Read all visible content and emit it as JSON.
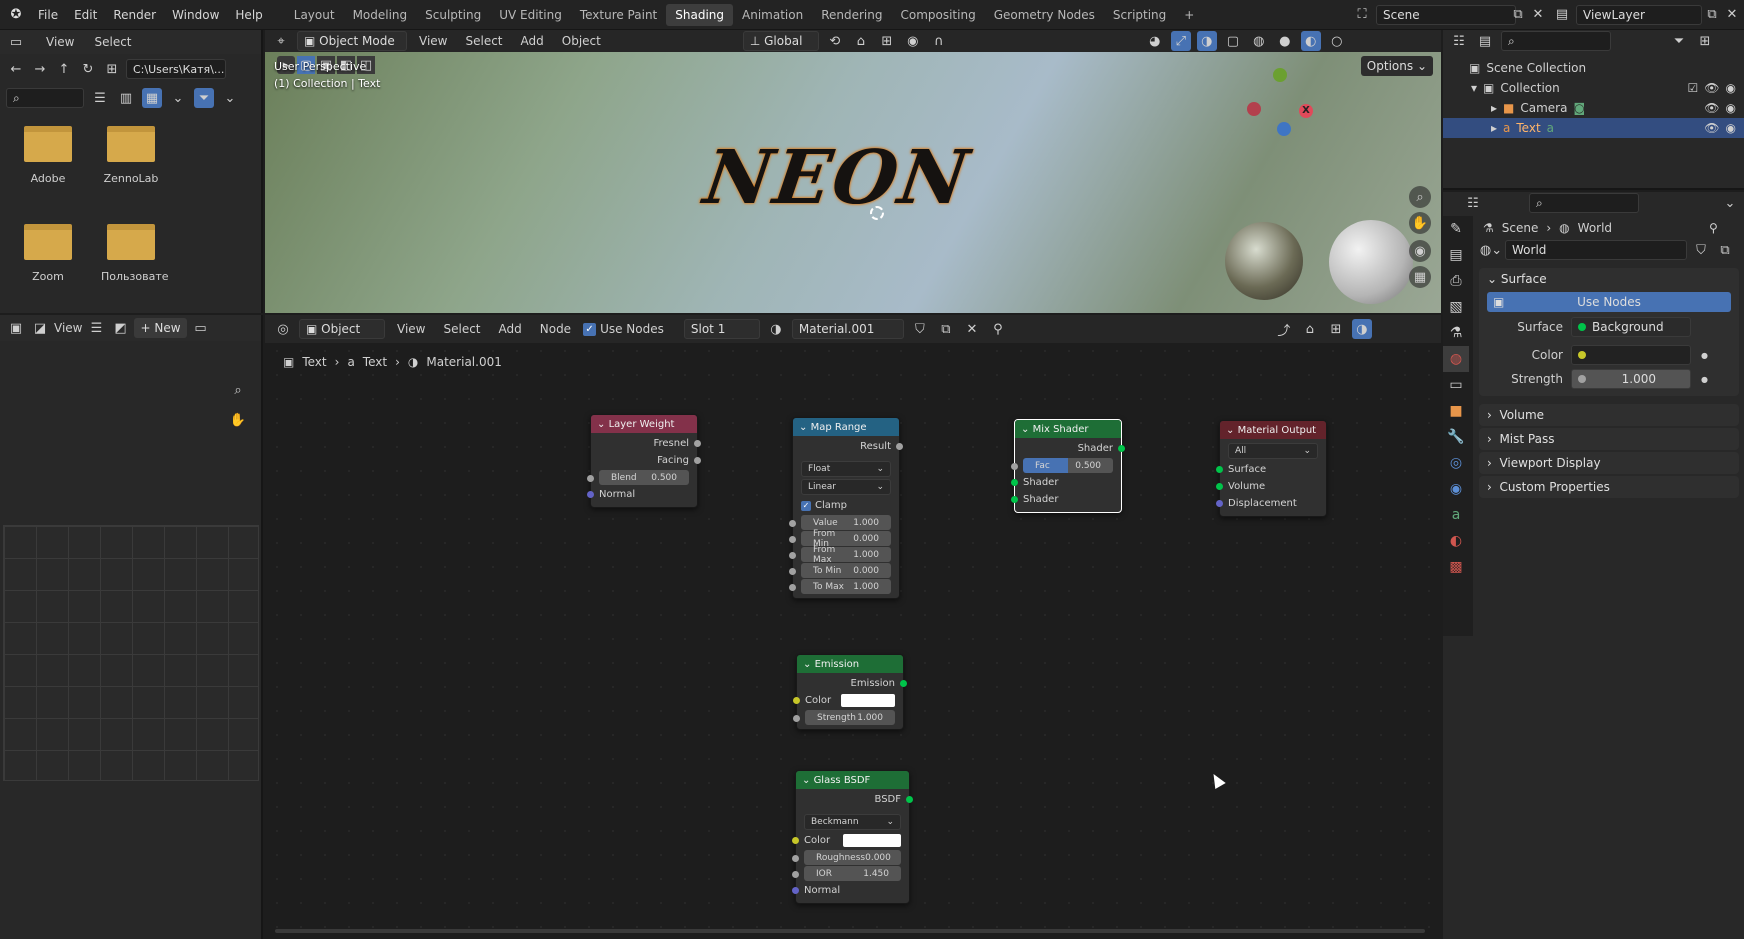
{
  "topbar": {
    "menus": [
      "File",
      "Edit",
      "Render",
      "Window",
      "Help"
    ],
    "workspaces": [
      "Layout",
      "Modeling",
      "Sculpting",
      "UV Editing",
      "Texture Paint",
      "Shading",
      "Animation",
      "Rendering",
      "Compositing",
      "Geometry Nodes",
      "Scripting"
    ],
    "active_workspace": "Shading",
    "add_tab": "+",
    "scene": "Scene",
    "view_layer": "ViewLayer"
  },
  "file_browser": {
    "menus": [
      "View",
      "Select"
    ],
    "path": "C:\\Users\\Катя\\...",
    "folders": [
      "Adobe",
      "ZennoLab",
      "Zoom",
      "Пользовате"
    ]
  },
  "image_editor": {
    "view_label": "View",
    "new_label": "New"
  },
  "viewport": {
    "mode": "Object Mode",
    "menus": [
      "View",
      "Select",
      "Add",
      "Object"
    ],
    "transform": "Global",
    "options_label": "Options",
    "info_line1": "User Perspective",
    "info_line2": "(1) Collection | Text",
    "neon_text": "NEON",
    "gizmo_x": "X"
  },
  "outliner": {
    "scene_collection": "Scene Collection",
    "collection": "Collection",
    "items": [
      "Camera",
      "Text"
    ]
  },
  "node_editor": {
    "object_label": "Object",
    "menus": [
      "View",
      "Select",
      "Add",
      "Node"
    ],
    "use_nodes": "Use Nodes",
    "slot": "Slot 1",
    "material": "Material.001",
    "breadcrumb": [
      "Text",
      "Text",
      "Material.001"
    ],
    "nodes": {
      "layer_weight": {
        "title": "Layer Weight",
        "out1": "Fresnel",
        "out2": "Facing",
        "blend_label": "Blend",
        "blend_value": "0.500",
        "normal": "Normal"
      },
      "map_range": {
        "title": "Map Range",
        "result": "Result",
        "type": "Float",
        "interp": "Linear",
        "clamp": "Clamp",
        "fields": [
          {
            "label": "Value",
            "value": "1.000"
          },
          {
            "label": "From Min",
            "value": "0.000"
          },
          {
            "label": "From Max",
            "value": "1.000"
          },
          {
            "label": "To Min",
            "value": "0.000"
          },
          {
            "label": "To Max",
            "value": "1.000"
          }
        ]
      },
      "mix_shader": {
        "title": "Mix Shader",
        "out": "Shader",
        "fac_label": "Fac",
        "fac_value": "0.500",
        "in1": "Shader",
        "in2": "Shader"
      },
      "material_output": {
        "title": "Material Output",
        "target": "All",
        "in1": "Surface",
        "in2": "Volume",
        "in3": "Displacement"
      },
      "emission": {
        "title": "Emission",
        "out": "Emission",
        "color": "Color",
        "strength_label": "Strength",
        "strength_value": "1.000"
      },
      "glass": {
        "title": "Glass BSDF",
        "out": "BSDF",
        "dist": "Beckmann",
        "color": "Color",
        "rough_label": "Roughness",
        "rough_value": "0.000",
        "ior_label": "IOR",
        "ior_value": "1.450",
        "normal": "Normal"
      }
    }
  },
  "properties": {
    "breadcrumb_scene": "Scene",
    "breadcrumb_world": "World",
    "world_name": "World",
    "surface_panel": "Surface",
    "use_nodes": "Use Nodes",
    "surface_label": "Surface",
    "surface_value": "Background",
    "color_label": "Color",
    "strength_label": "Strength",
    "strength_value": "1.000",
    "panels": [
      "Volume",
      "Mist Pass",
      "Viewport Display",
      "Custom Properties"
    ]
  },
  "colors": {
    "accent": "#4772b3",
    "selected_row": "#334d80",
    "layer_weight_header": "#83314a",
    "map_range_header": "#246283",
    "shader_header": "#1e6e36",
    "output_header": "#63232b"
  }
}
